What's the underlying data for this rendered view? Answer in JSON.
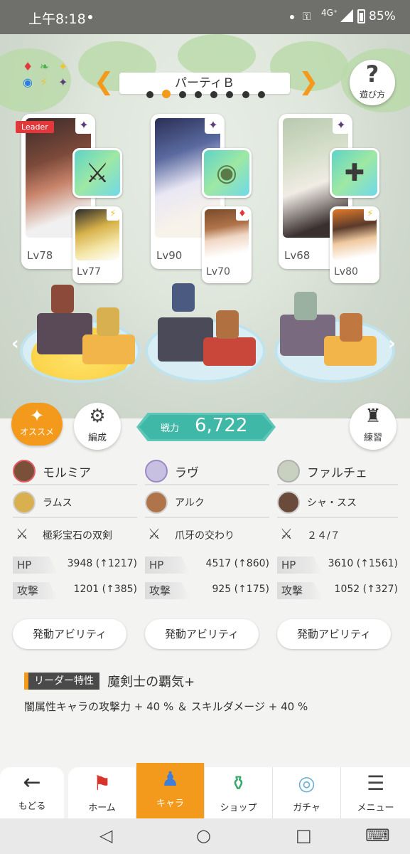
{
  "status_bar": {
    "time": "上午8:18",
    "network": "4G⁺",
    "battery": "85%"
  },
  "header": {
    "party_name": "パーティＢ",
    "help_label": "遊び方",
    "party_pages": 8,
    "party_active_index": 1
  },
  "team": [
    {
      "main_level": "Lv78",
      "sub_level": "Lv77",
      "leader_tag": "Leader",
      "element": "✦",
      "sub_element": "⚡",
      "weapon_icon": "⚔"
    },
    {
      "main_level": "Lv90",
      "sub_level": "Lv70",
      "element": "✦",
      "sub_element": "♦",
      "weapon_icon": "◉"
    },
    {
      "main_level": "Lv68",
      "sub_level": "Lv80",
      "element": "✦",
      "sub_element": "⚡",
      "weapon_icon": "✚"
    }
  ],
  "controls": {
    "recommend_label": "オススメ",
    "formation_label": "編成",
    "power_label": "戦力",
    "power_value": "6,722",
    "training_label": "練習"
  },
  "columns": [
    {
      "name": "モルミア",
      "sub_name": "ラムス",
      "weapon": "極彩宝石の双剣",
      "hp_label": "HP",
      "hp": "3948 (↑1217)",
      "atk_label": "攻撃",
      "atk": "1201 (↑385)",
      "ability_button": "発動アビリティ"
    },
    {
      "name": "ラヴ",
      "sub_name": "アルク",
      "weapon": "爪牙の交わり",
      "hp_label": "HP",
      "hp": "4517 (↑860)",
      "atk_label": "攻撃",
      "atk": "925 (↑175)",
      "ability_button": "発動アビリティ"
    },
    {
      "name": "ファルチェ",
      "sub_name": "シャ・スス",
      "weapon": "２４/７",
      "hp_label": "HP",
      "hp": "3610 (↑1561)",
      "atk_label": "攻撃",
      "atk": "1052 (↑327)",
      "ability_button": "発動アビリティ"
    }
  ],
  "leader_skill": {
    "tag": "リーダー特性",
    "name": "魔剣士の覇気+",
    "description": "闇属性キャラの攻撃力 + 40 % ＆ スキルダメージ + 40 %"
  },
  "bottom_nav": {
    "back": "もどる",
    "tabs": [
      "ホーム",
      "キャラ",
      "ショップ",
      "ガチャ",
      "メニュー"
    ],
    "active_tab": "キャラ"
  },
  "colors": {
    "accent_orange": "#f39a1c",
    "power_teal": "#3fb8a7"
  }
}
